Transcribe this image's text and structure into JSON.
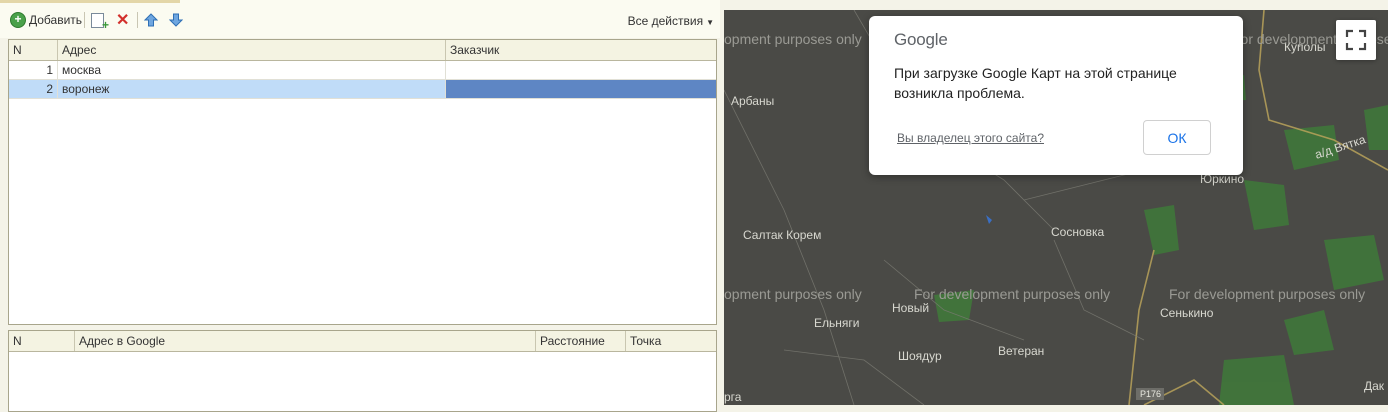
{
  "toolbar": {
    "add_label": "Добавить",
    "actions_label": "Все действия",
    "icons": [
      "add-icon",
      "copy-icon",
      "delete-icon",
      "move-up-icon",
      "move-down-icon"
    ]
  },
  "grid1": {
    "columns": [
      "N",
      "Адрес",
      "Заказчик"
    ],
    "rows": [
      {
        "n": "1",
        "address": "москва",
        "customer": ""
      },
      {
        "n": "2",
        "address": "воронеж",
        "customer": ""
      }
    ],
    "selected_row": 2
  },
  "grid2": {
    "columns": [
      "N",
      "Адрес в Google",
      "Расстояние",
      "Точка"
    ]
  },
  "map": {
    "watermark": "For development purposes only",
    "watermark_partial": "opment purposes only",
    "labels": [
      "Арбаны",
      "Салтак Корем",
      "Сосновка",
      "Юркино",
      "а/д Вятка",
      "Куполы",
      "Ельняги",
      "Новый",
      "Шоядур",
      "Ветеран",
      "Сенькино",
      "Р176",
      "Дак",
      "рга"
    ],
    "fullscreen_icon": "fullscreen-icon"
  },
  "dialog": {
    "logo": "Google",
    "message_line1": "При загрузке Google Карт на этой странице",
    "message_line2": "возникла проблема.",
    "owner_link": "Вы владелец этого сайта?",
    "ok_label": "ОК"
  },
  "colors": {
    "selection": "#c0dcf8",
    "active_cell": "#5e86c4",
    "map_bg": "#4a4a46",
    "forest": "#3f7a3a",
    "road": "#b8a25a"
  }
}
